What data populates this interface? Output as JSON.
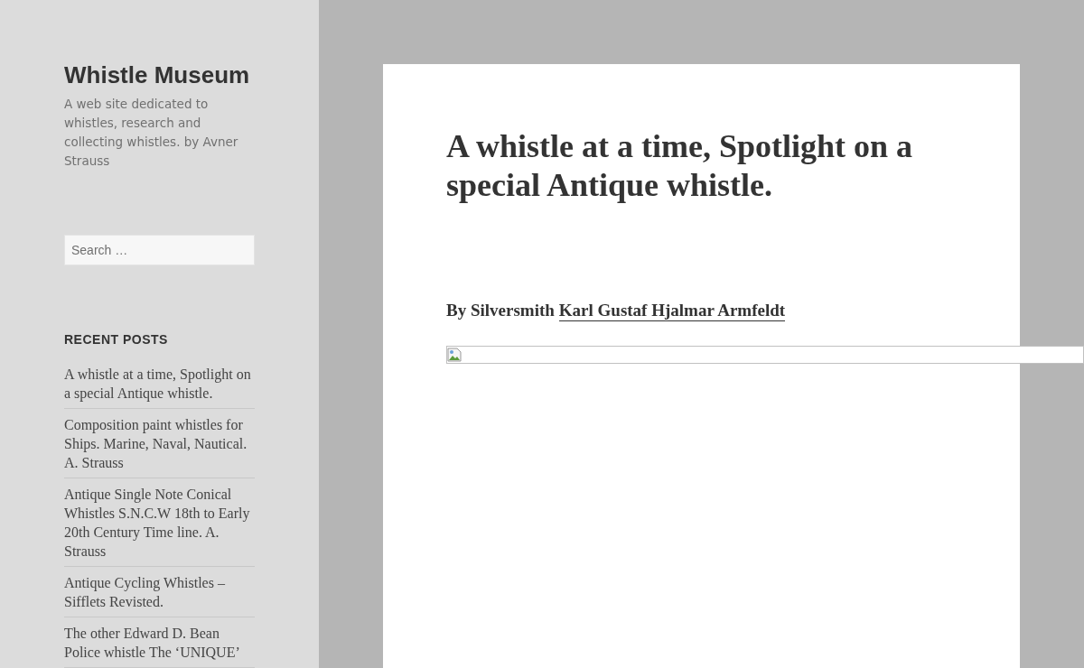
{
  "sidebar": {
    "site_title": "Whistle Museum",
    "description": "A web site dedicated to whistles, research and collecting whistles. by Avner Strauss",
    "search": {
      "placeholder": "Search …"
    },
    "recent_posts": {
      "heading": "RECENT POSTS",
      "items": [
        {
          "title": "A whistle at a time, Spotlight on a special Antique whistle."
        },
        {
          "title": "Composition paint whistles for Ships. Marine, Naval, Nautical. A. Strauss"
        },
        {
          "title": "Antique Single Note Conical Whistles S.N.C.W 18th to Early 20th Century Time line. A. Strauss"
        },
        {
          "title": "Antique Cycling Whistles – Sifflets Revisted."
        },
        {
          "title": "The other Edward D. Bean Police whistle The ‘UNIQUE’"
        }
      ]
    }
  },
  "article": {
    "title": "A whistle at a time, Spotlight on a special Antique whistle.",
    "byline": {
      "prefix": "By Silversmith",
      "author_link": "Karl Gustaf Hjalmar Armfeldt"
    }
  }
}
